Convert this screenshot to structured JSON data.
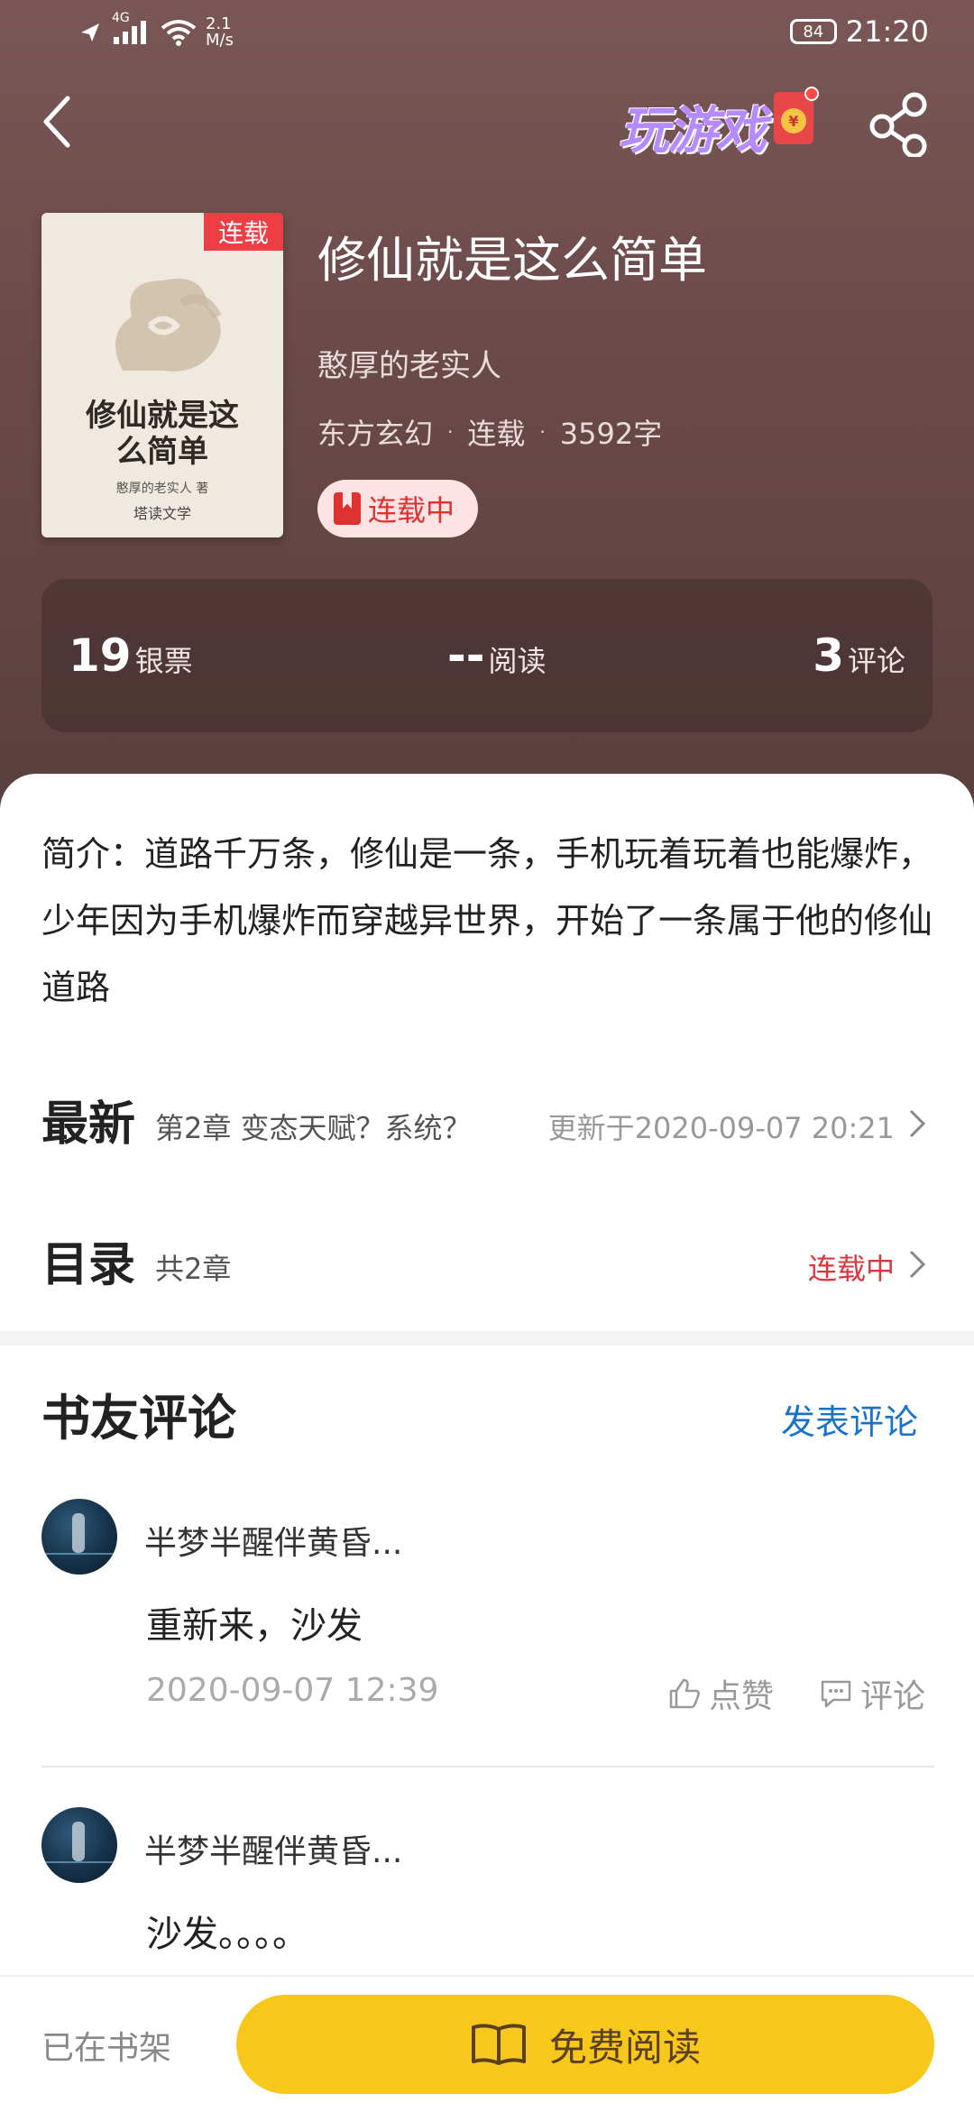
{
  "status_bar": {
    "network": "4G",
    "speed_value": "2.1",
    "speed_unit": "M/s",
    "battery": "84",
    "time": "21:20"
  },
  "nav": {
    "game_label": "玩游戏",
    "coin_symbol": "¥"
  },
  "book": {
    "cover_badge": "连载",
    "cover_title": "修仙就是这么简单",
    "cover_author": "憨厚的老实人 著",
    "cover_publisher": "塔读文学",
    "title": "修仙就是这么简单",
    "author": "憨厚的老实人",
    "genre": "东方玄幻",
    "serial_status": "连载",
    "word_count": "3592字",
    "status_pill": "连载中"
  },
  "stats": [
    {
      "value": "19",
      "label": "银票"
    },
    {
      "value": "--",
      "label": "阅读"
    },
    {
      "value": "3",
      "label": "评论"
    }
  ],
  "intro": "简介：道路千万条，修仙是一条，手机玩着玩着也能爆炸，少年因为手机爆炸而穿越异世界，开始了一条属于他的修仙道路",
  "latest": {
    "heading": "最新",
    "chapter": "第2章 变态天赋？系统？",
    "updated": "更新于2020-09-07 20:21"
  },
  "toc": {
    "heading": "目录",
    "count": "共2章",
    "status": "连载中"
  },
  "comments_section": {
    "title": "书友评论",
    "post_label": "发表评论",
    "items": [
      {
        "user": "半梦半醒伴黄昏...",
        "text": "重新来，沙发",
        "time": "2020-09-07 12:39",
        "like_label": "点赞",
        "reply_label": "评论"
      },
      {
        "user": "半梦半醒伴黄昏...",
        "text": "沙发。。。。"
      }
    ]
  },
  "bottom": {
    "shelf_label": "已在书架",
    "read_label": "免费阅读"
  },
  "colors": {
    "hero_bg": "#6a4a49",
    "accent_red": "#e03131",
    "link_blue": "#1a73c9",
    "cta_yellow": "#f7c81b"
  }
}
